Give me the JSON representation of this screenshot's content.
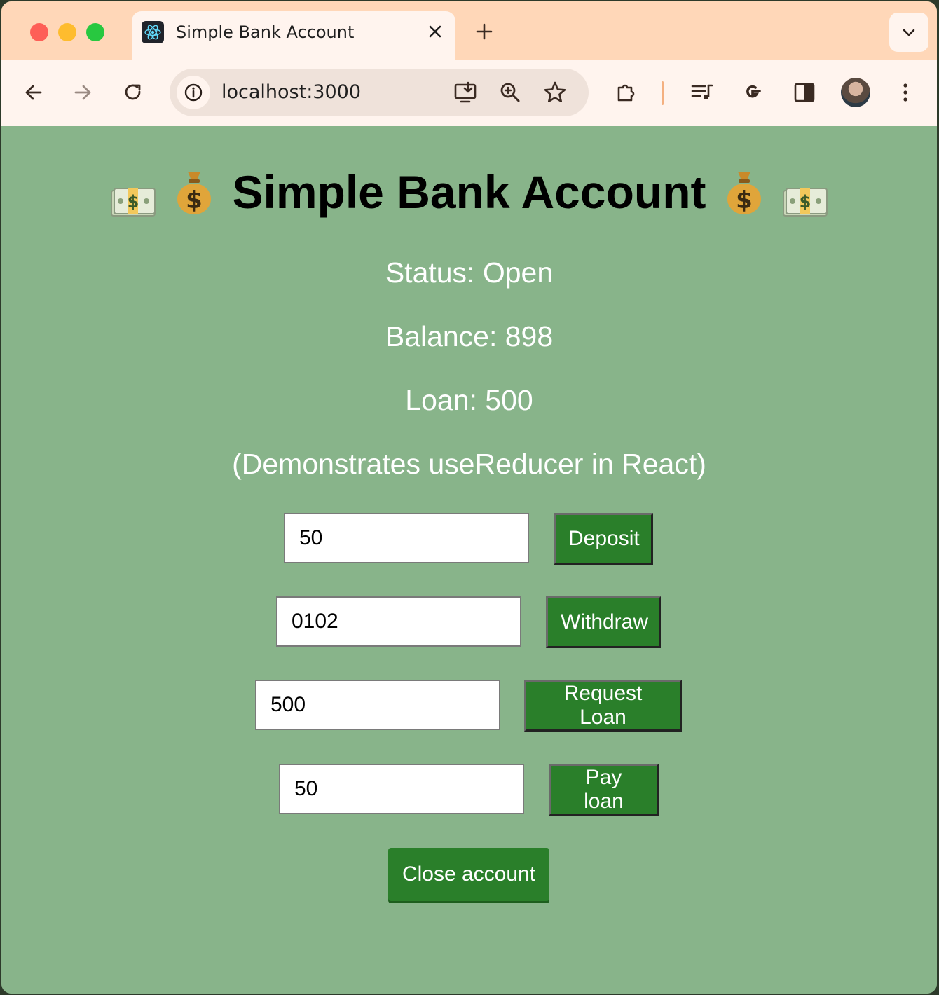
{
  "browser": {
    "tab_title": "Simple Bank Account",
    "url": "localhost:3000"
  },
  "page": {
    "heading": "Simple Bank Account",
    "status": "Status: Open",
    "balance": "Balance: 898",
    "loan": "Loan: 500",
    "note": "(Demonstrates useReducer in React)",
    "deposit": {
      "value": "50",
      "label": "Deposit"
    },
    "withdraw": {
      "value": "0102",
      "label": "Withdraw"
    },
    "request_loan": {
      "value": "500",
      "label": "Request Loan"
    },
    "pay_loan": {
      "value": "50",
      "label": "Pay loan"
    },
    "close_label": "Close account"
  },
  "colors": {
    "page_bg": "#88b48a",
    "button": "#2a7f2a",
    "tabstrip": "#ffd7b8"
  },
  "icons": [
    "react-logo-icon",
    "close-icon",
    "plus-icon",
    "chevron-down-icon",
    "back-arrow-icon",
    "forward-arrow-icon",
    "reload-icon",
    "info-icon",
    "install-icon",
    "zoom-icon",
    "star-icon",
    "extensions-icon",
    "media-icon",
    "google-icon",
    "side-panel-icon",
    "kebab-menu-icon",
    "money-bill-emoji",
    "money-bag-emoji"
  ]
}
